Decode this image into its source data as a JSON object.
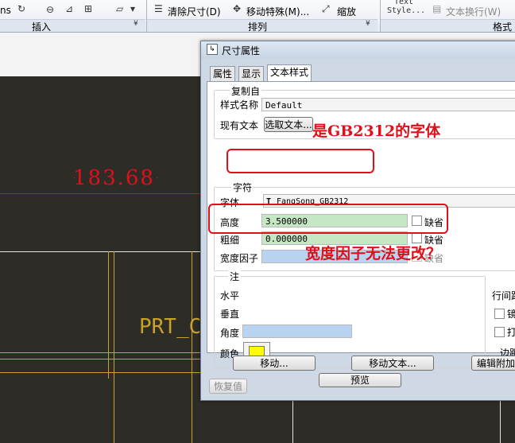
{
  "ribbon": {
    "frag_left": "ns",
    "clear_dims": "清除尺寸(D)",
    "move_special": "移动特殊(M)...",
    "zoom": "缩放",
    "text_small": "Text",
    "style_small": "Style...",
    "text_wrap": "文本换行(W)",
    "group_insert": "插入",
    "group_arrange": "排列",
    "group_format": "格式"
  },
  "drawing": {
    "dimension_value": "183.68",
    "part_label": "PRT_C"
  },
  "dialog": {
    "title": "尺寸属性",
    "tabs": [
      "属性",
      "显示",
      "文本样式"
    ],
    "copy_from": {
      "title": "复制自",
      "style_name_label": "样式名称",
      "style_name_value": "Default",
      "existing_text_label": "现有文本",
      "select_text_button": "选取文本..."
    },
    "char": {
      "title": "字符",
      "font_label": "字体",
      "font_value": "FangSong_GB2312",
      "height_label": "高度",
      "height_value": "3.500000",
      "thickness_label": "粗细",
      "thickness_value": "0.000000",
      "width_factor_label": "宽度因子",
      "width_factor_value": "",
      "default_label": "缺省"
    },
    "note": {
      "title": "注",
      "horizontal_label": "水平",
      "vertical_label": "垂直",
      "angle_label": "角度",
      "color_label": "颜色",
      "color_value": "#ffff00",
      "line_spacing_label": "行间距",
      "mirror_label": "镜",
      "strike_label": "打",
      "margin_label": "边距",
      "preview_button": "预览"
    },
    "buttons": {
      "move": "移动...",
      "move_text": "移动文本...",
      "edit_attached": "编辑附加"
    },
    "restore_button": "恢复值"
  },
  "annotations": {
    "font_note": "是GB2312的字体",
    "width_note": "宽度因子无法更改？"
  },
  "colors": {
    "annotation_red": "#e0101a",
    "dimension_red": "#e0101a"
  }
}
